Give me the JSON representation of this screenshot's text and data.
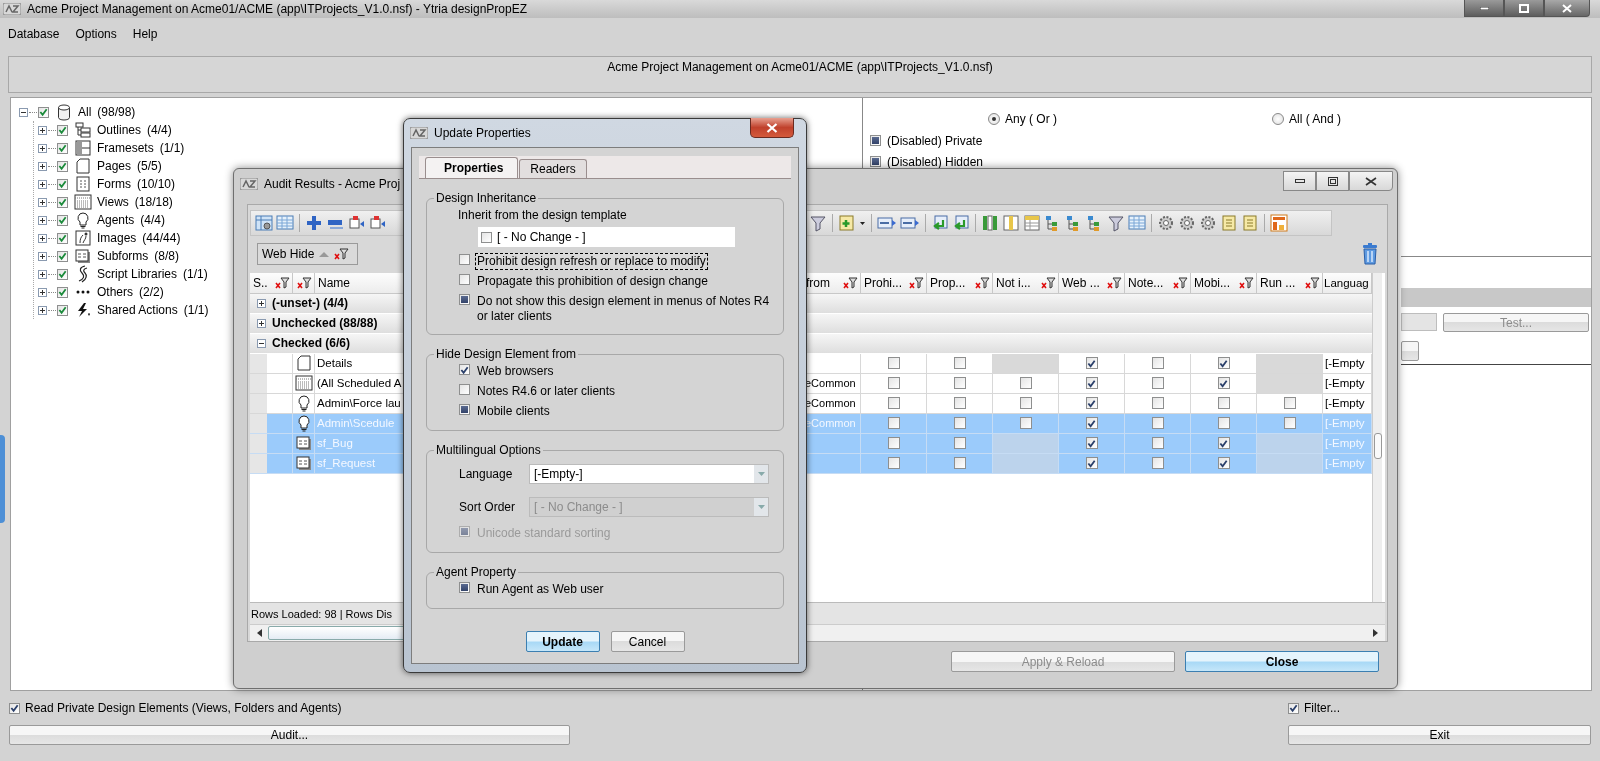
{
  "window": {
    "title": "Acme Project Management on Acme01/ACME (app\\ITProjects_V1.0.nsf) - Ytria designPropEZ"
  },
  "menu": [
    "Database",
    "Options",
    "Help"
  ],
  "header": {
    "text": "Acme Project Management on Acme01/ACME (app\\ITProjects_V1.0.nsf)"
  },
  "tree": {
    "label": "All",
    "count": "(98/98)",
    "kind": "database",
    "checked": true,
    "expanded": true,
    "children": [
      {
        "label": "Outlines",
        "count": "(4/4)",
        "kind": "outline",
        "checked": true,
        "expanded": false
      },
      {
        "label": "Framesets",
        "count": "(1/1)",
        "kind": "frameset",
        "checked": true,
        "expanded": false
      },
      {
        "label": "Pages",
        "count": "(5/5)",
        "kind": "page",
        "checked": true,
        "expanded": false
      },
      {
        "label": "Forms",
        "count": "(10/10)",
        "kind": "form",
        "checked": true,
        "expanded": false
      },
      {
        "label": "Views",
        "count": "(18/18)",
        "kind": "view",
        "checked": true,
        "expanded": false
      },
      {
        "label": "Agents",
        "count": "(4/4)",
        "kind": "agent",
        "checked": true,
        "expanded": false
      },
      {
        "label": "Images",
        "count": "(44/44)",
        "kind": "image",
        "checked": true,
        "expanded": false
      },
      {
        "label": "Subforms",
        "count": "(8/8)",
        "kind": "subform",
        "checked": true,
        "expanded": false
      },
      {
        "label": "Script Libraries",
        "count": "(1/1)",
        "kind": "script",
        "checked": true,
        "expanded": false
      },
      {
        "label": "Others",
        "count": "(2/2)",
        "kind": "others",
        "checked": true,
        "expanded": false
      },
      {
        "label": "Shared Actions",
        "count": "(1/1)",
        "kind": "action",
        "checked": true,
        "expanded": false
      }
    ]
  },
  "filter_panel": {
    "match": [
      {
        "label": "Any ( Or )",
        "selected": true
      },
      {
        "label": "All ( And )",
        "selected": false
      }
    ],
    "options": [
      {
        "label": "(Disabled) Private",
        "checked": false,
        "indeterminate": true
      },
      {
        "label": "(Disabled) Hidden",
        "checked": false,
        "indeterminate": true
      }
    ],
    "test_button": {
      "label": "Test...",
      "disabled": true
    }
  },
  "audit": {
    "title": "Audit Results - Acme Proj",
    "group_by": {
      "label": "Web Hide"
    },
    "columns": [
      {
        "label": "S..",
        "filter": true
      },
      {
        "label": "Name",
        "filter": false
      },
      {
        "label": "from",
        "filter": true
      },
      {
        "label": "Prohi...",
        "filter": true
      },
      {
        "label": "Prop...",
        "filter": true
      },
      {
        "label": "Not i...",
        "filter": true
      },
      {
        "label": "Web ...",
        "filter": true
      },
      {
        "label": "Note...",
        "filter": true
      },
      {
        "label": "Mobi...",
        "filter": true
      },
      {
        "label": "Run ...",
        "filter": true
      },
      {
        "label": "Languag"
      }
    ],
    "groups": [
      {
        "label": "(-unset-) (4/4)",
        "expanded": false
      },
      {
        "label": "Unchecked (88/88)",
        "expanded": false
      },
      {
        "label": "Checked (6/6)",
        "expanded": true,
        "rows": [
          {
            "kind": "page",
            "name": "Details",
            "selected": false,
            "flags": [
              {
                "kind": "checkbox",
                "checked": false
              },
              {
                "kind": "checkbox",
                "checked": false
              },
              {
                "kind": "blank"
              },
              {
                "kind": "checkbox",
                "checked": true
              },
              {
                "kind": "checkbox",
                "checked": false
              },
              {
                "kind": "checkbox",
                "checked": true
              },
              {
                "kind": "blank"
              }
            ],
            "language": "[-Empty"
          },
          {
            "kind": "view",
            "name": "(All Scheduled A",
            "from": "eCommon",
            "selected": false,
            "flags": [
              {
                "kind": "checkbox",
                "checked": false
              },
              {
                "kind": "checkbox",
                "checked": false
              },
              {
                "kind": "checkbox",
                "checked": false
              },
              {
                "kind": "checkbox",
                "checked": true
              },
              {
                "kind": "checkbox",
                "checked": false
              },
              {
                "kind": "checkbox",
                "checked": true
              },
              {
                "kind": "blank"
              }
            ],
            "language": "[-Empty"
          },
          {
            "kind": "agent",
            "name": "Admin\\Force lau",
            "from": "eCommon",
            "selected": false,
            "flags": [
              {
                "kind": "checkbox",
                "checked": false
              },
              {
                "kind": "checkbox",
                "checked": false
              },
              {
                "kind": "checkbox",
                "checked": false
              },
              {
                "kind": "checkbox",
                "checked": true
              },
              {
                "kind": "checkbox",
                "checked": false
              },
              {
                "kind": "checkbox",
                "checked": false
              },
              {
                "kind": "checkbox",
                "checked": false
              }
            ],
            "language": "[-Empty"
          },
          {
            "kind": "agent",
            "name": "Admin\\Scedule",
            "from": "eCommon",
            "selected": true,
            "flags": [
              {
                "kind": "checkbox",
                "checked": false
              },
              {
                "kind": "checkbox",
                "checked": false
              },
              {
                "kind": "checkbox",
                "checked": false
              },
              {
                "kind": "checkbox",
                "checked": true
              },
              {
                "kind": "checkbox",
                "checked": false
              },
              {
                "kind": "checkbox",
                "checked": false
              },
              {
                "kind": "checkbox",
                "checked": false
              }
            ],
            "language": "[-Empty"
          },
          {
            "kind": "subform",
            "name": "sf_Bug",
            "selected": true,
            "flags": [
              {
                "kind": "checkbox",
                "checked": false
              },
              {
                "kind": "checkbox",
                "checked": false
              },
              {
                "kind": "blank"
              },
              {
                "kind": "checkbox",
                "checked": true
              },
              {
                "kind": "checkbox",
                "checked": false
              },
              {
                "kind": "checkbox",
                "checked": true
              },
              {
                "kind": "blank"
              }
            ],
            "language": "[-Empty"
          },
          {
            "kind": "subform",
            "name": "sf_Request",
            "selected": true,
            "flags": [
              {
                "kind": "checkbox",
                "checked": false
              },
              {
                "kind": "checkbox",
                "checked": false
              },
              {
                "kind": "blank"
              },
              {
                "kind": "checkbox",
                "checked": true
              },
              {
                "kind": "checkbox",
                "checked": false
              },
              {
                "kind": "checkbox",
                "checked": true
              },
              {
                "kind": "blank"
              }
            ],
            "language": "[-Empty"
          }
        ]
      }
    ],
    "status": "Rows Loaded: 98 | Rows Dis",
    "buttons": [
      {
        "label": "Apply & Reload",
        "disabled": true,
        "default": false
      },
      {
        "label": "Close",
        "disabled": false,
        "default": true
      }
    ]
  },
  "dialog": {
    "title": "Update Properties",
    "tabs": [
      {
        "label": "Properties",
        "selected": true
      },
      {
        "label": "Readers",
        "selected": false
      }
    ],
    "sections": [
      {
        "title": "Design Inheritance",
        "items": [
          {
            "kind": "label",
            "text": "Inherit from the design template"
          },
          {
            "kind": "check_field",
            "label": "[ - No Change - ]",
            "checked": false,
            "indeterminate": false
          },
          {
            "kind": "checkbox",
            "label": "Prohibit design refresh or replace to modify",
            "checked": false,
            "indeterminate": false,
            "disabled": false,
            "focused": true
          },
          {
            "kind": "checkbox",
            "label": "Propagate this prohibition of design change",
            "checked": false,
            "indeterminate": false,
            "disabled": false,
            "focused": false
          },
          {
            "kind": "checkbox",
            "label": "Do not show this design element in menus of Notes R4 or later clients",
            "checked": false,
            "indeterminate": true,
            "disabled": false,
            "focused": false
          }
        ]
      },
      {
        "title": "Hide Design Element from",
        "items": [
          {
            "kind": "checkbox",
            "label": "Web browsers",
            "checked": true,
            "indeterminate": false,
            "disabled": false,
            "focused": false
          },
          {
            "kind": "checkbox",
            "label": "Notes R4.6 or later clients",
            "checked": false,
            "indeterminate": false,
            "disabled": false,
            "focused": false
          },
          {
            "kind": "checkbox",
            "label": "Mobile clients",
            "checked": false,
            "indeterminate": true,
            "disabled": false,
            "focused": false
          }
        ]
      },
      {
        "title": "Multilingual Options",
        "items": [
          {
            "kind": "combo",
            "label": "Language",
            "value": "[-Empty-]",
            "disabled": false
          },
          {
            "kind": "combo",
            "label": "Sort Order",
            "value": "[ - No Change - ]",
            "disabled": true
          },
          {
            "kind": "checkbox",
            "label": "Unicode standard sorting",
            "checked": false,
            "indeterminate": true,
            "disabled": true,
            "focused": false
          }
        ]
      },
      {
        "title": "Agent Property",
        "items": [
          {
            "kind": "checkbox",
            "label": "Run Agent as Web user",
            "checked": false,
            "indeterminate": true,
            "disabled": false,
            "focused": false
          }
        ]
      }
    ],
    "buttons": [
      {
        "label": "Update",
        "default": true
      },
      {
        "label": "Cancel",
        "default": false
      }
    ]
  },
  "bottom": {
    "read_private": {
      "label": "Read Private Design Elements (Views, Folders and Agents)",
      "checked": true
    },
    "filter": {
      "label": "Filter...",
      "checked": true
    },
    "audit_button": "Audit...",
    "exit_button": "Exit"
  }
}
